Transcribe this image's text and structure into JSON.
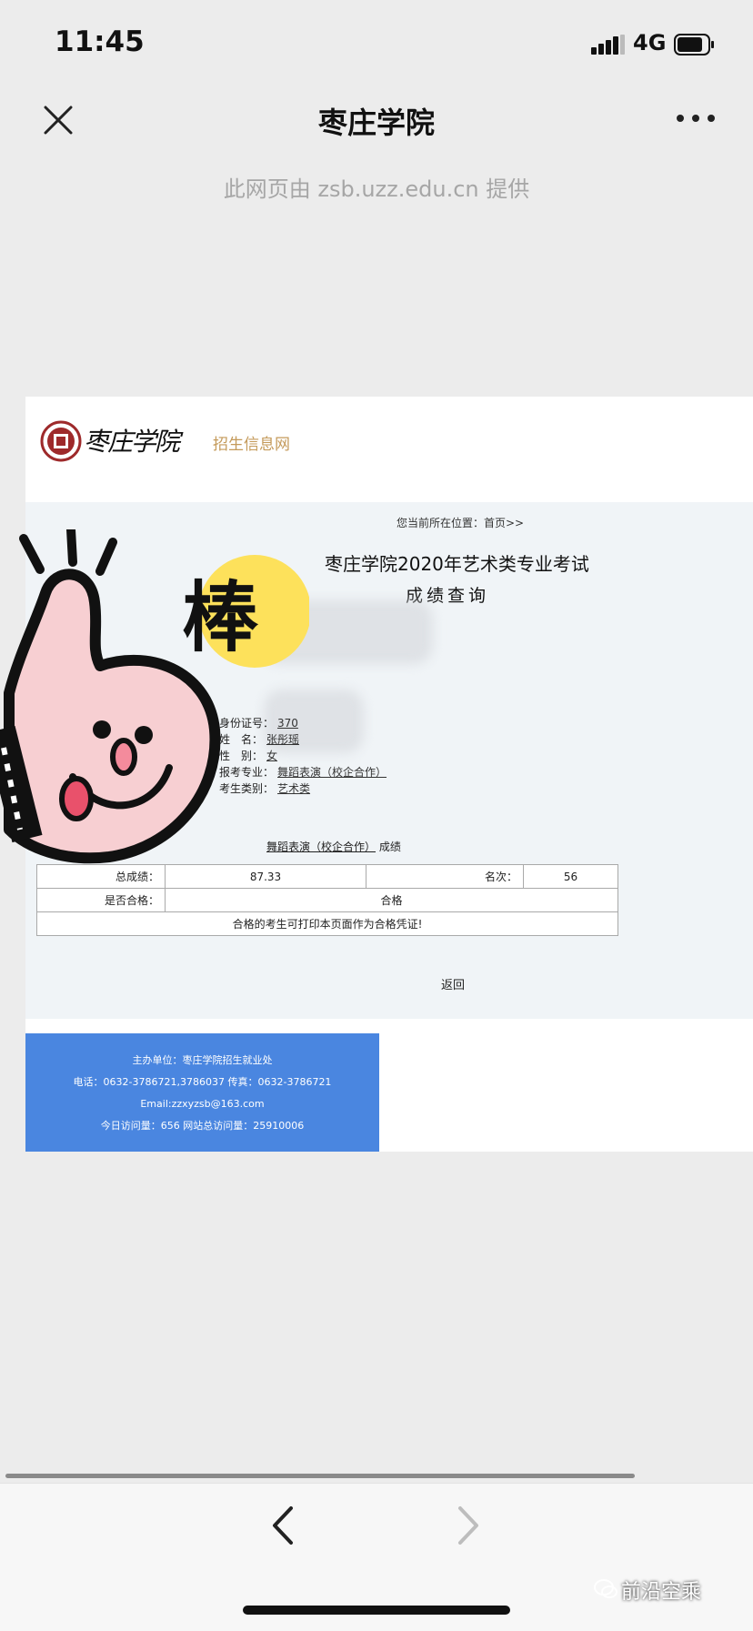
{
  "status_bar": {
    "time": "11:45",
    "network": "4G"
  },
  "title_bar": {
    "title": "枣庄学院",
    "provider": "此网页由 zsb.uzz.edu.cn 提供"
  },
  "web": {
    "logo_text": "枣庄学院",
    "site_name": "招生信息网",
    "breadcrumb": "您当前所在位置：首页>>",
    "heading1": "枣庄学院2020年艺术类专业考试",
    "heading2": "成绩查询",
    "fields": [
      {
        "label": "身份证号：",
        "value": "370"
      },
      {
        "label": "姓　名：",
        "value": "张彤瑶"
      },
      {
        "label": "性　别：",
        "value": "女"
      },
      {
        "label": "报考专业：",
        "value": "舞蹈表演（校企合作）"
      },
      {
        "label": "考生类别：",
        "value": "艺术类"
      }
    ],
    "subject_name": "舞蹈表演（校企合作）",
    "subject_suffix": "成绩",
    "table": {
      "total_label": "总成绩：",
      "total_value": "87.33",
      "rank_label": "名次：",
      "rank_value": "56",
      "pass_label": "是否合格：",
      "pass_value": "合格",
      "note": "合格的考生可打印本页面作为合格凭证!"
    },
    "back": "返回",
    "footer": [
      "主办单位：枣庄学院招生就业处",
      "电话：0632-3786721,3786037 传真：0632-3786721",
      "Email:zzxyzsb@163.com",
      "今日访问量：656 网站总访问量：25910006"
    ]
  },
  "sticker": {
    "text": "棒"
  },
  "watermark": "前沿空乘",
  "colors": {
    "accent_gold": "#c49a5a",
    "footer_blue": "#4a86e0",
    "sticker_yellow": "#fde15b",
    "sticker_pink": "#f7cfd2"
  }
}
